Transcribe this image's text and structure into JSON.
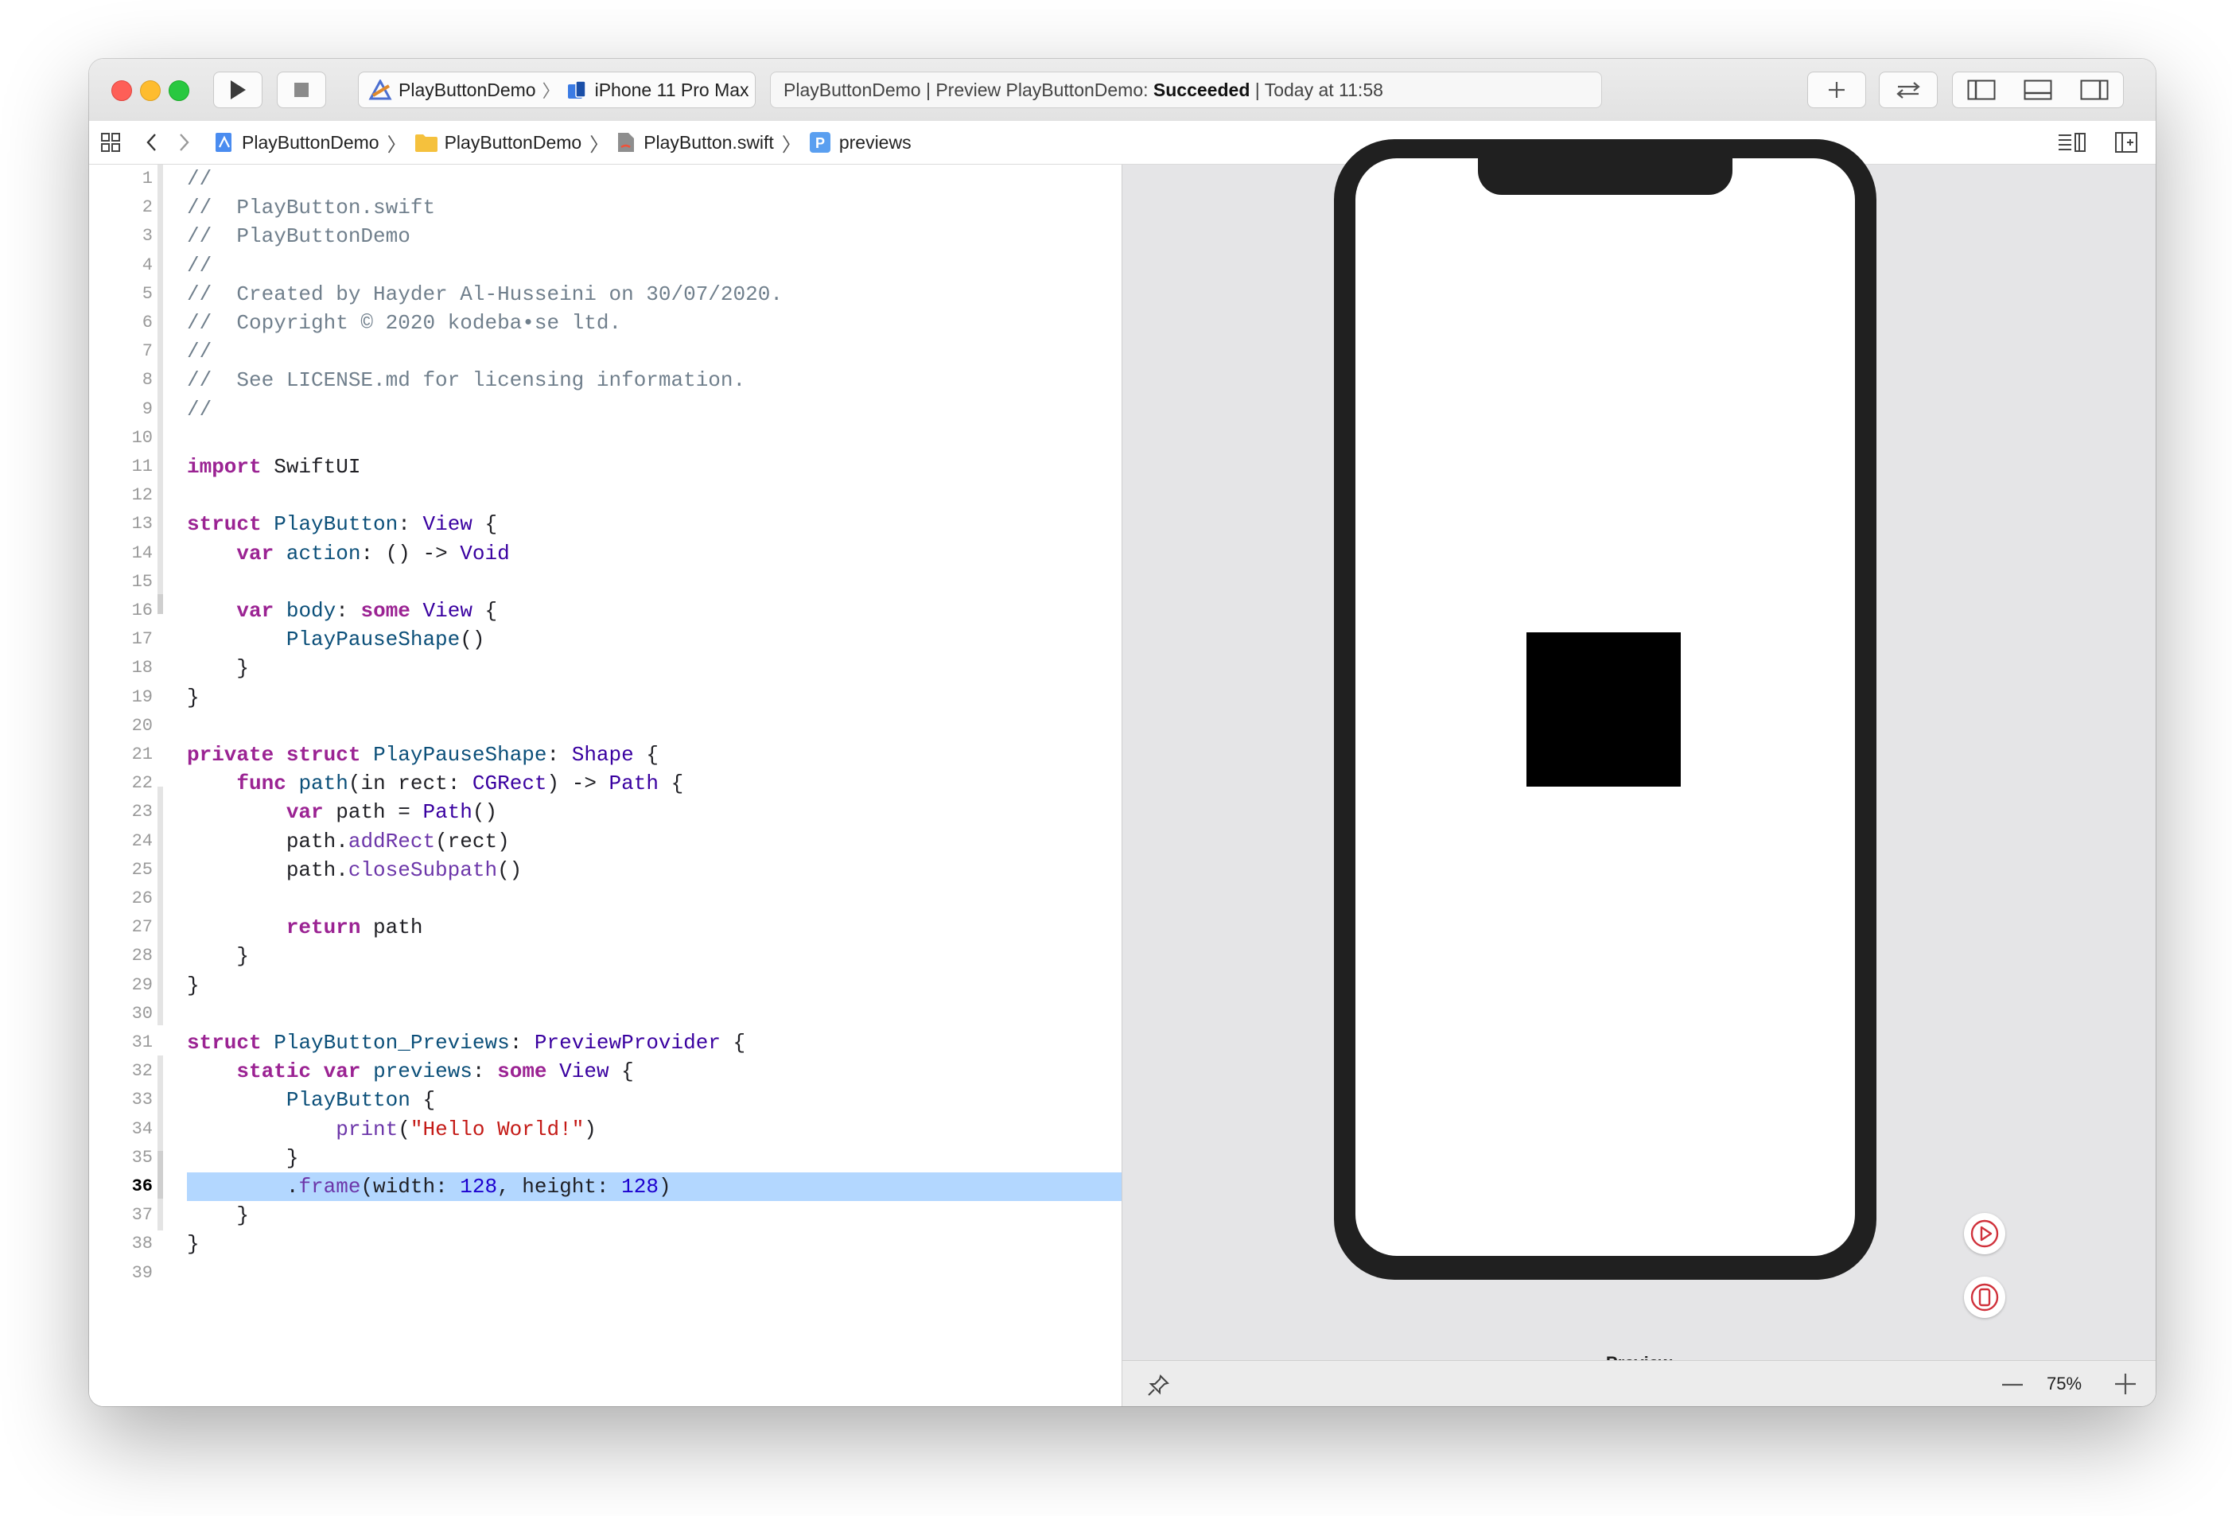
{
  "toolbar": {
    "scheme_project": "PlayButtonDemo",
    "scheme_device": "iPhone 11 Pro Max",
    "activity_prefix": "PlayButtonDemo | Preview PlayButtonDemo: ",
    "activity_status": "Succeeded",
    "activity_suffix": " | Today at 11:58",
    "icons": [
      "run-icon",
      "stop-icon",
      "plus-icon",
      "swap-icon",
      "navigator-panel-icon",
      "debug-panel-icon",
      "inspector-panel-icon"
    ]
  },
  "jumpbar": {
    "crumbs": [
      "PlayButtonDemo",
      "PlayButtonDemo",
      "PlayButton.swift",
      "previews"
    ]
  },
  "editor": {
    "current_line": 36,
    "line_numbers": [
      "1",
      "2",
      "3",
      "4",
      "5",
      "6",
      "7",
      "8",
      "9",
      "10",
      "11",
      "12",
      "13",
      "14",
      "15",
      "16",
      "17",
      "18",
      "19",
      "20",
      "21",
      "22",
      "23",
      "24",
      "25",
      "26",
      "27",
      "28",
      "29",
      "30",
      "31",
      "32",
      "33",
      "34",
      "35",
      "36",
      "37",
      "38",
      "39"
    ],
    "lines": [
      [
        [
          "c",
          "//"
        ]
      ],
      [
        [
          "c",
          "//  PlayButton.swift"
        ]
      ],
      [
        [
          "c",
          "//  PlayButtonDemo"
        ]
      ],
      [
        [
          "c",
          "//"
        ]
      ],
      [
        [
          "c",
          "//  Created by Hayder Al-Husseini on 30/07/2020."
        ]
      ],
      [
        [
          "c",
          "//  Copyright © 2020 kodeba•se ltd."
        ]
      ],
      [
        [
          "c",
          "//"
        ]
      ],
      [
        [
          "c",
          "//  See LICENSE.md for licensing information."
        ]
      ],
      [
        [
          "c",
          "//"
        ]
      ],
      [],
      [
        [
          "k",
          "import"
        ],
        [
          "p",
          " SwiftUI"
        ]
      ],
      [],
      [
        [
          "k",
          "struct"
        ],
        [
          "p",
          " "
        ],
        [
          "t",
          "PlayButton"
        ],
        [
          "p",
          ": "
        ],
        [
          "tl2",
          "View"
        ],
        [
          "p",
          " {"
        ]
      ],
      [
        [
          "p",
          "    "
        ],
        [
          "k",
          "var"
        ],
        [
          "p",
          " "
        ],
        [
          "t",
          "action"
        ],
        [
          "p",
          ": () -> "
        ],
        [
          "tl2",
          "Void"
        ]
      ],
      [],
      [
        [
          "p",
          "    "
        ],
        [
          "k",
          "var"
        ],
        [
          "p",
          " "
        ],
        [
          "t",
          "body"
        ],
        [
          "p",
          ": "
        ],
        [
          "k",
          "some"
        ],
        [
          "p",
          " "
        ],
        [
          "tl2",
          "View"
        ],
        [
          "p",
          " {"
        ]
      ],
      [
        [
          "p",
          "        "
        ],
        [
          "t",
          "PlayPauseShape"
        ],
        [
          "p",
          "()"
        ]
      ],
      [
        [
          "p",
          "    }"
        ]
      ],
      [
        [
          "p",
          "}"
        ]
      ],
      [],
      [
        [
          "k",
          "private"
        ],
        [
          "p",
          " "
        ],
        [
          "k",
          "struct"
        ],
        [
          "p",
          " "
        ],
        [
          "t",
          "PlayPauseShape"
        ],
        [
          "p",
          ": "
        ],
        [
          "tl2",
          "Shape"
        ],
        [
          "p",
          " {"
        ]
      ],
      [
        [
          "p",
          "    "
        ],
        [
          "k",
          "func"
        ],
        [
          "p",
          " "
        ],
        [
          "t",
          "path"
        ],
        [
          "p",
          "(in rect: "
        ],
        [
          "tl2",
          "CGRect"
        ],
        [
          "p",
          ") -> "
        ],
        [
          "tl2",
          "Path"
        ],
        [
          "p",
          " {"
        ]
      ],
      [
        [
          "p",
          "        "
        ],
        [
          "k",
          "var"
        ],
        [
          "p",
          " path = "
        ],
        [
          "tl2",
          "Path"
        ],
        [
          "p",
          "()"
        ]
      ],
      [
        [
          "p",
          "        path."
        ],
        [
          "f",
          "addRect"
        ],
        [
          "p",
          "(rect)"
        ]
      ],
      [
        [
          "p",
          "        path."
        ],
        [
          "f",
          "closeSubpath"
        ],
        [
          "p",
          "()"
        ]
      ],
      [],
      [
        [
          "p",
          "        "
        ],
        [
          "k",
          "return"
        ],
        [
          "p",
          " path"
        ]
      ],
      [
        [
          "p",
          "    }"
        ]
      ],
      [
        [
          "p",
          "}"
        ]
      ],
      [],
      [
        [
          "k",
          "struct"
        ],
        [
          "p",
          " "
        ],
        [
          "t",
          "PlayButton_Previews"
        ],
        [
          "p",
          ": "
        ],
        [
          "tl2",
          "PreviewProvider"
        ],
        [
          "p",
          " {"
        ]
      ],
      [
        [
          "p",
          "    "
        ],
        [
          "k",
          "static"
        ],
        [
          "p",
          " "
        ],
        [
          "k",
          "var"
        ],
        [
          "p",
          " "
        ],
        [
          "t",
          "previews"
        ],
        [
          "p",
          ": "
        ],
        [
          "k",
          "some"
        ],
        [
          "p",
          " "
        ],
        [
          "tl2",
          "View"
        ],
        [
          "p",
          " {"
        ]
      ],
      [
        [
          "p",
          "        "
        ],
        [
          "t",
          "PlayButton"
        ],
        [
          "p",
          " {"
        ]
      ],
      [
        [
          "p",
          "            "
        ],
        [
          "f",
          "print"
        ],
        [
          "p",
          "("
        ],
        [
          "s",
          "\"Hello World!\""
        ],
        [
          "p",
          ")"
        ]
      ],
      [
        [
          "p",
          "        }"
        ]
      ],
      [
        [
          "p",
          "        ."
        ],
        [
          "f",
          "frame"
        ],
        [
          "p",
          "(width: "
        ],
        [
          "n",
          "128"
        ],
        [
          "p",
          ", height: "
        ],
        [
          "n",
          "128"
        ],
        [
          "p",
          ")"
        ]
      ],
      [
        [
          "p",
          "    }"
        ]
      ],
      [
        [
          "p",
          "}"
        ]
      ],
      []
    ]
  },
  "canvas": {
    "device_label": "Preview",
    "zoom": "75%",
    "icons": [
      "pin-icon",
      "live-preview-icon",
      "device-preview-icon",
      "zoom-out-icon",
      "zoom-in-icon"
    ]
  },
  "colors": {
    "selection": "#b3d7ff",
    "keyword": "#9b2393",
    "comment": "#707f8c",
    "type_decl": "#0b4f79",
    "type_ref": "#3900a0",
    "string": "#c41a16",
    "number": "#1c00cf"
  }
}
